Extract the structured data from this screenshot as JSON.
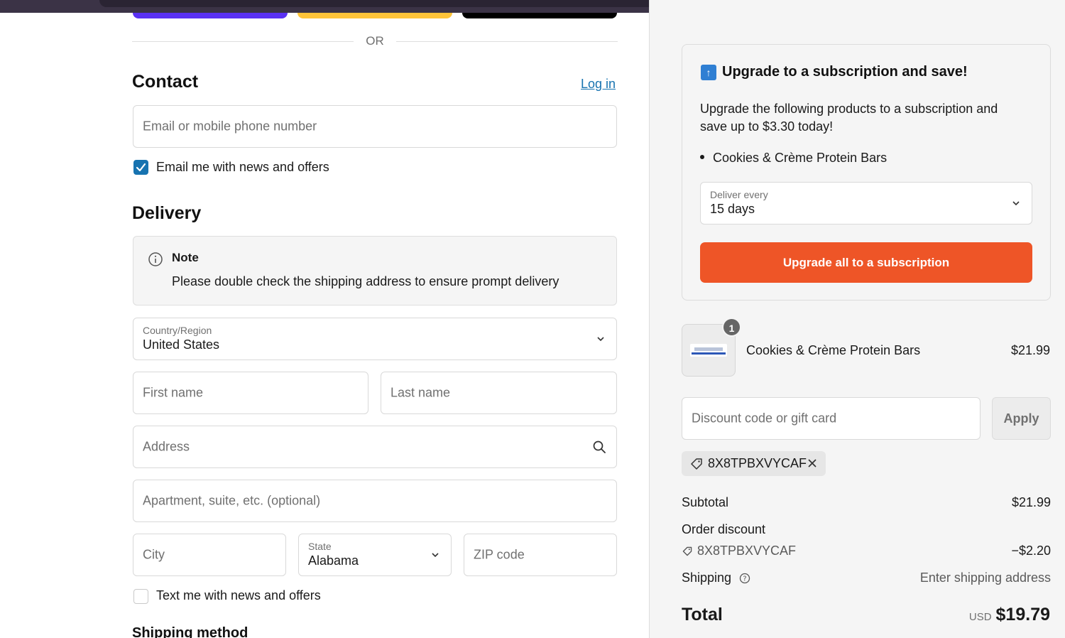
{
  "express": {
    "or_label": "OR"
  },
  "contact": {
    "heading": "Contact",
    "login_link": "Log in",
    "email_placeholder": "Email or mobile phone number",
    "news_checkbox_label": "Email me with news and offers",
    "news_checked": true
  },
  "delivery": {
    "heading": "Delivery",
    "note_title": "Note",
    "note_body": "Please double check the shipping address to ensure prompt delivery",
    "country_label": "Country/Region",
    "country_value": "United States",
    "first_name_placeholder": "First name",
    "last_name_placeholder": "Last name",
    "address_placeholder": "Address",
    "apartment_placeholder": "Apartment, suite, etc. (optional)",
    "city_placeholder": "City",
    "state_label": "State",
    "state_value": "Alabama",
    "zip_placeholder": "ZIP code",
    "text_checkbox_label": "Text me with news and offers",
    "text_checked": false,
    "shipping_method_heading": "Shipping method"
  },
  "upsell": {
    "badge_icon": "up-arrow-icon",
    "title": "Upgrade to a subscription and save!",
    "description": "Upgrade the following products to a subscription and save up to $3.30 today!",
    "items": [
      "Cookies & Crème Protein Bars"
    ],
    "frequency_label": "Deliver every",
    "frequency_value": "15 days",
    "button_label": "Upgrade all to a subscription",
    "button_color": "#ee5527"
  },
  "order": {
    "product_name": "Cookies & Crème Protein Bars",
    "product_qty": "1",
    "product_price": "$21.99",
    "discount_placeholder": "Discount code or gift card",
    "apply_label": "Apply",
    "applied_code": "8X8TPBXVYCAF",
    "subtotal_label": "Subtotal",
    "subtotal_value": "$21.99",
    "order_discount_label": "Order discount",
    "discount_code": "8X8TPBXVYCAF",
    "discount_value": "−$2.20",
    "shipping_label": "Shipping",
    "shipping_value": "Enter shipping address",
    "total_label": "Total",
    "total_currency": "USD",
    "total_value": "$19.79"
  },
  "colors": {
    "link": "#1773b0",
    "accent": "#ee5527",
    "checkbox": "#1773b0"
  }
}
